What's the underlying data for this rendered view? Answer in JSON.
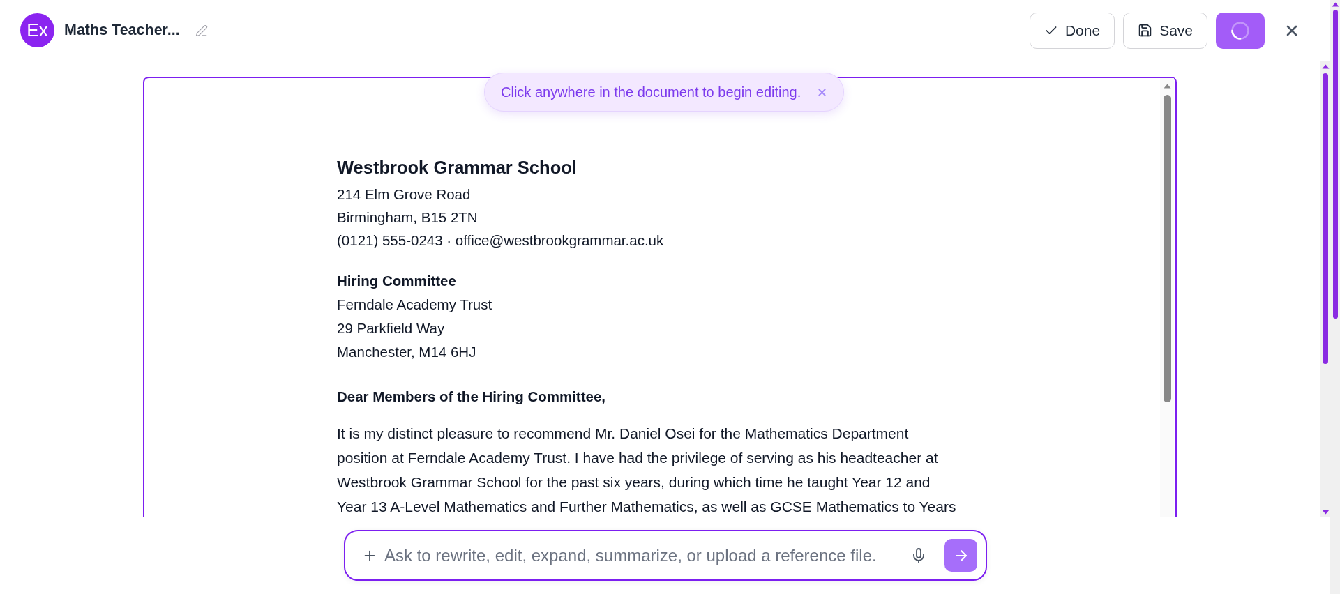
{
  "header": {
    "avatar": "Ex",
    "title": "Maths Teacher...",
    "actions": [
      {
        "kind": "done",
        "label": "Done"
      },
      {
        "kind": "save",
        "label": "Save"
      },
      {
        "kind": "loading"
      }
    ]
  },
  "notice": {
    "text": "Click anywhere in the document to begin editing."
  },
  "document": {
    "sender": {
      "name": "Westbrook Grammar School",
      "lines": [
        "214 Elm Grove Road",
        "Birmingham, B15 2TN",
        "(0121) 555-0243 · office@westbrookgrammar.ac.uk"
      ]
    },
    "recipient": {
      "title": "Hiring Committee",
      "lines": [
        "Ferndale Academy Trust",
        "29 Parkfield Way",
        "Manchester, M14 6HJ"
      ]
    },
    "salutation": "Dear Members of the Hiring Committee,",
    "paragraphs": [
      {
        "lines": [
          "It is my distinct pleasure to recommend Mr. Daniel Osei for the Mathematics Department",
          "position at Ferndale Academy Trust. I have had the privilege of serving as his headteacher at",
          "Westbrook Grammar School for the past six years, during which time he taught Year 12 and",
          "Year 13 A-Level Mathematics and Further Mathematics, as well as GCSE Mathematics to Years"
        ]
      }
    ]
  },
  "prompt": {
    "placeholder": "Ask to rewrite, edit, expand, summarize, or upload a reference file."
  }
}
